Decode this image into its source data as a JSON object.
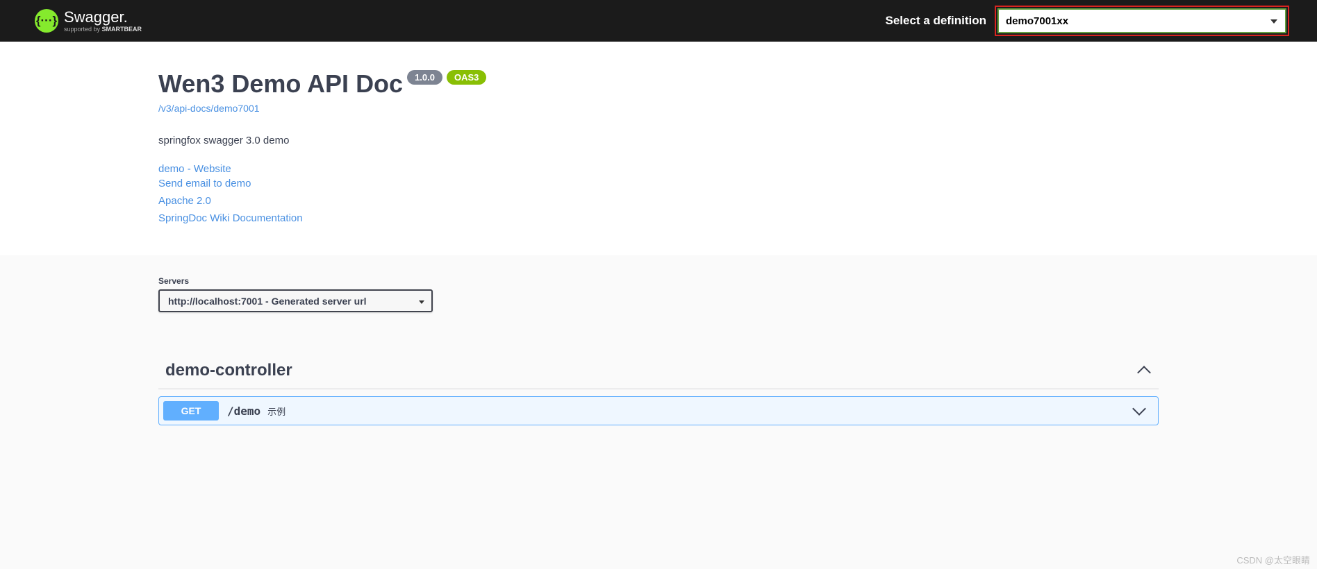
{
  "topbar": {
    "logo_text": "Swagger.",
    "logo_sub_prefix": "supported by ",
    "logo_sub_brand": "SMARTBEAR",
    "select_label": "Select a definition",
    "definition_selected": "demo7001xx"
  },
  "info": {
    "title": "Wen3 Demo API Doc",
    "version": "1.0.0",
    "oas": "OAS3",
    "spec_url": "/v3/api-docs/demo7001",
    "description": "springfox swagger 3.0 demo",
    "website_link": "demo - Website",
    "contact_link": "Send email to demo",
    "license_link": "Apache 2.0",
    "external_docs_link": "SpringDoc Wiki Documentation"
  },
  "servers": {
    "label": "Servers",
    "selected": "http://localhost:7001 - Generated server url"
  },
  "tag": {
    "name": "demo-controller"
  },
  "operation": {
    "method": "GET",
    "path": "/demo",
    "summary": "示例"
  },
  "watermark": "CSDN @太空眼睛"
}
